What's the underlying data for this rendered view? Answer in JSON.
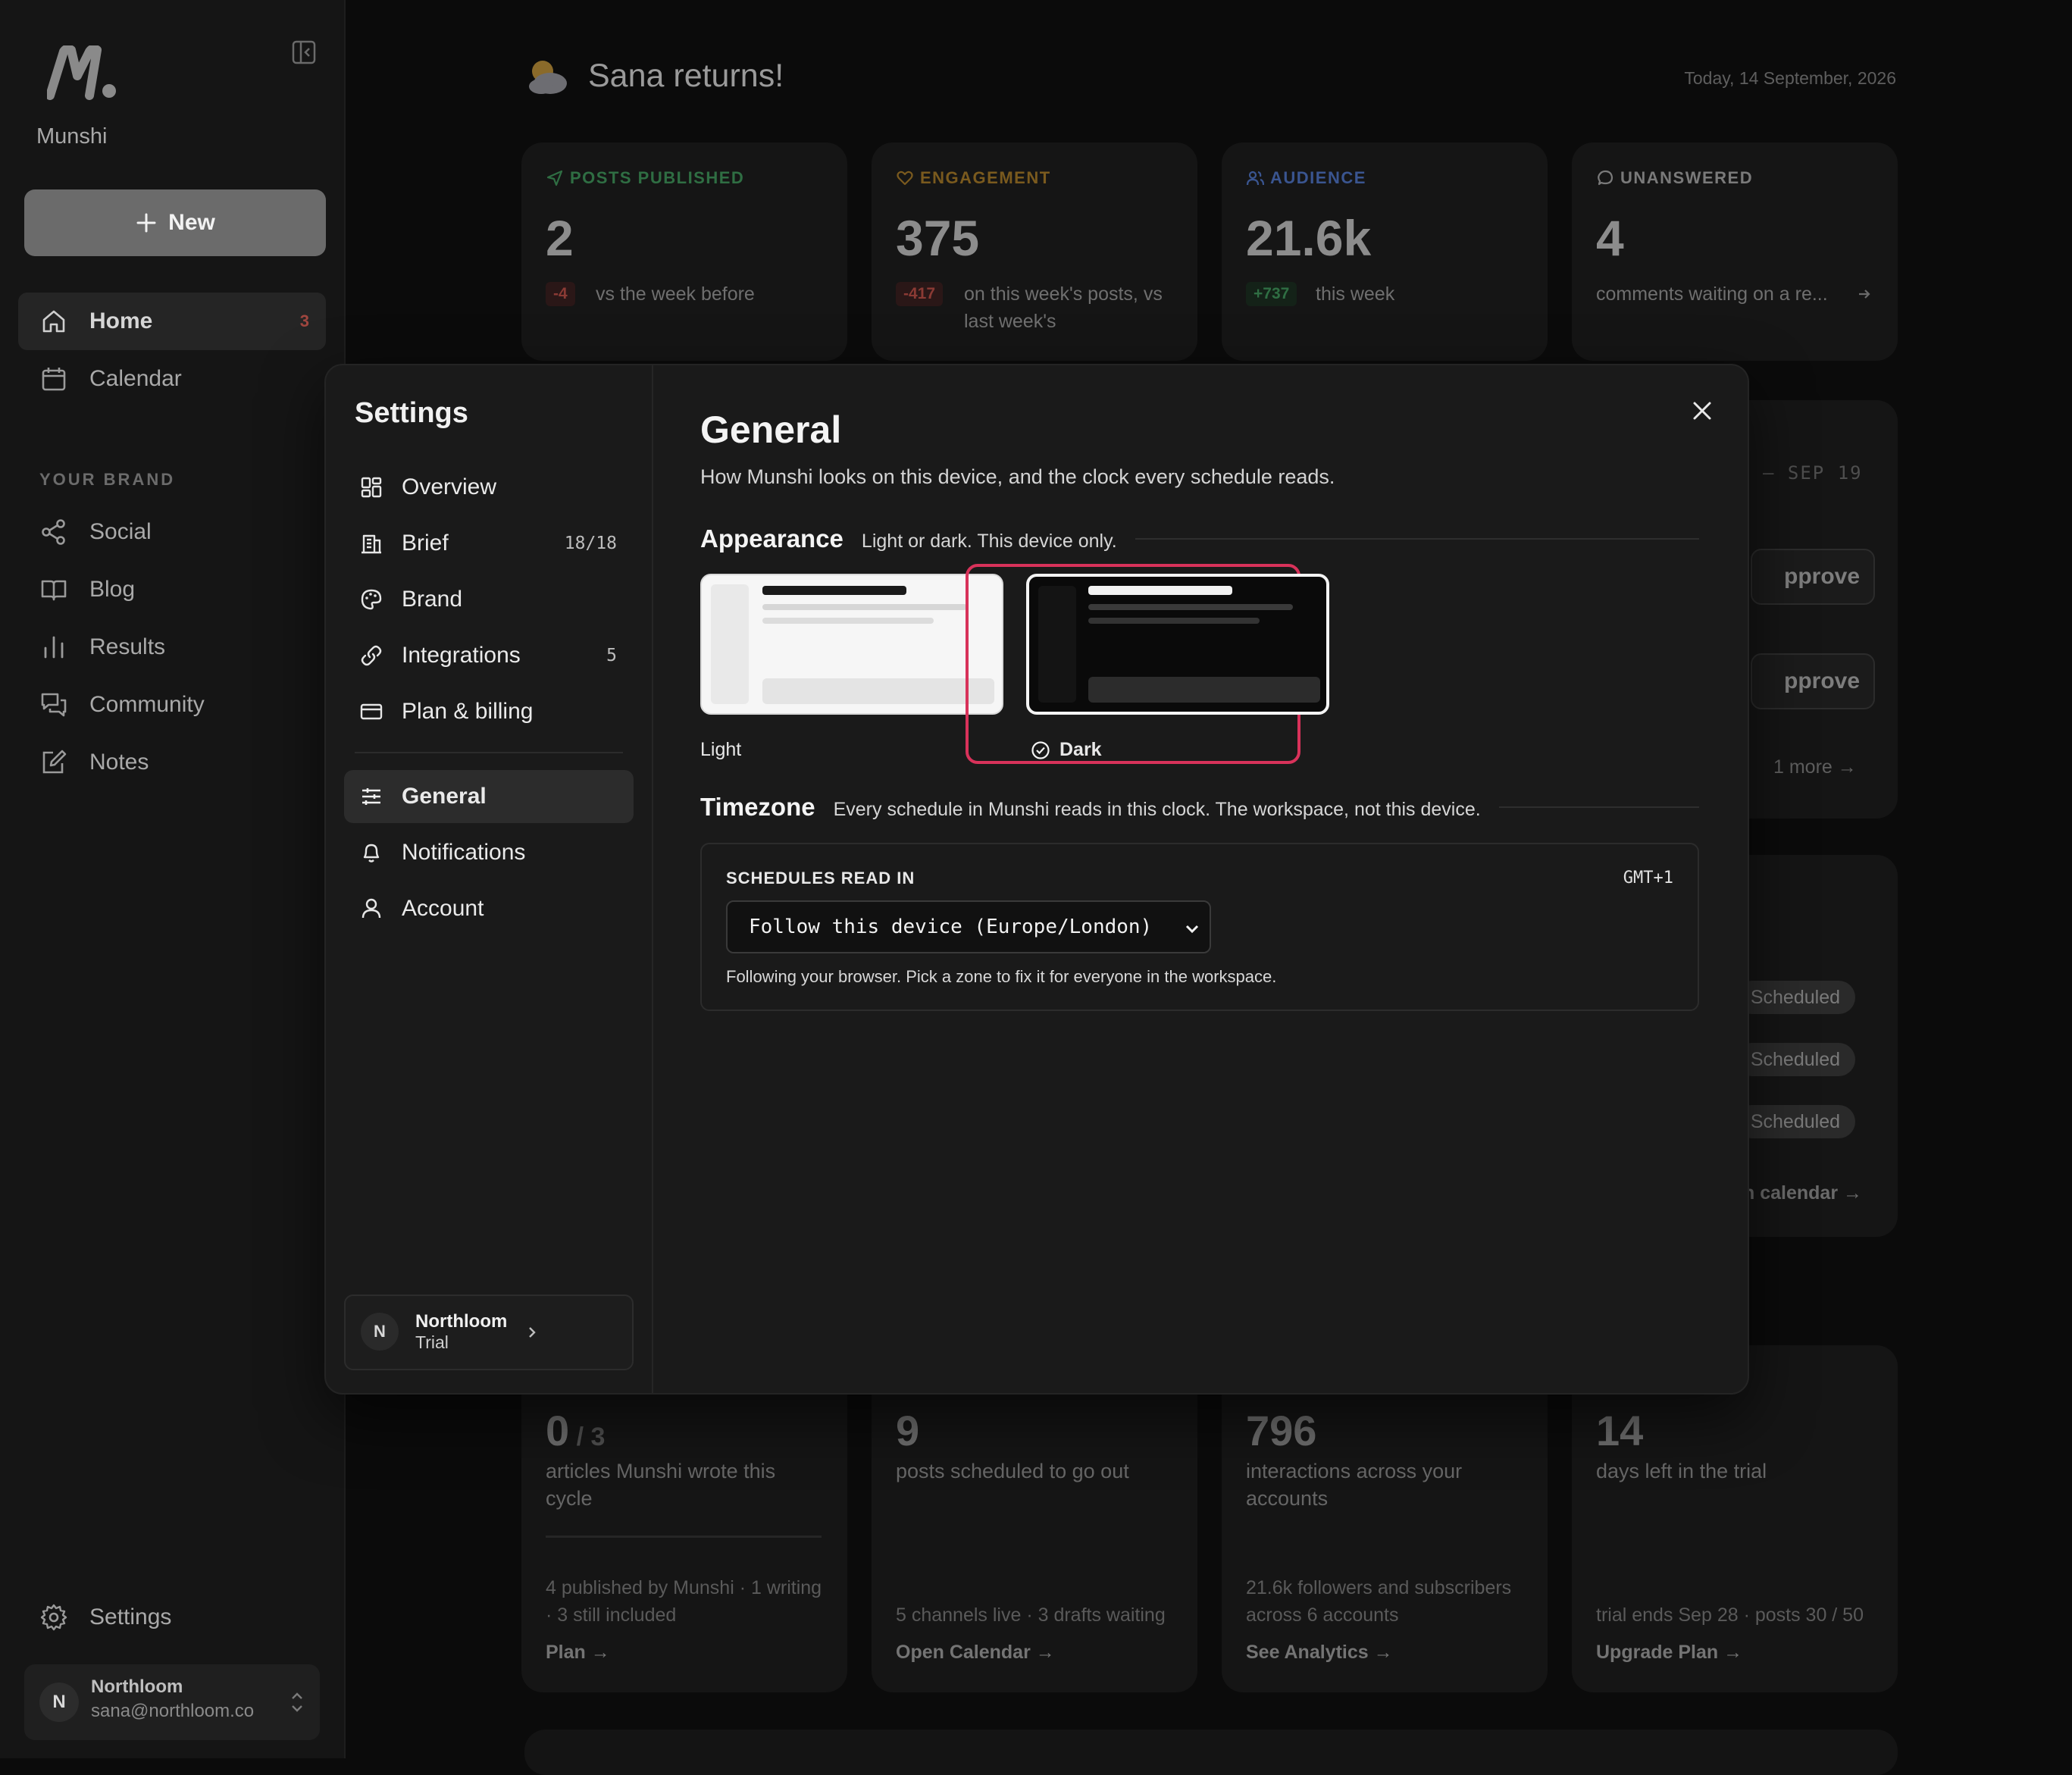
{
  "app": {
    "name": "Munshi",
    "new_label": "New",
    "nav": [
      {
        "label": "Home",
        "badge": "3"
      },
      {
        "label": "Calendar"
      }
    ],
    "brand_section_label": "YOUR BRAND",
    "brand_nav": [
      {
        "label": "Social"
      },
      {
        "label": "Blog"
      },
      {
        "label": "Results"
      },
      {
        "label": "Community"
      },
      {
        "label": "Notes"
      }
    ],
    "settings_label": "Settings",
    "user": {
      "initial": "N",
      "name": "Northloom",
      "email": "sana@northloom.co"
    }
  },
  "dashboard": {
    "greeting": "Sana returns!",
    "date": "Today, 14 September, 2026",
    "stats": [
      {
        "label": "POSTS PUBLISHED",
        "value": "2",
        "delta": "-4",
        "note": "vs the week before",
        "color": "#2f6e43"
      },
      {
        "label": "ENGAGEMENT",
        "value": "375",
        "delta": "-417",
        "note": "on this week's posts, vs last week's",
        "color": "#7a5a1e"
      },
      {
        "label": "AUDIENCE",
        "value": "21.6k",
        "delta": "+737",
        "note": "this week",
        "color": "#3a5590"
      },
      {
        "label": "UNANSWERED",
        "value": "4",
        "note": "comments waiting on a re..."
      }
    ],
    "week_range_tail": "– SEP 19",
    "approve_label": "pprove",
    "more_label": "1 more",
    "scheduled_label": "Scheduled",
    "calendar_link_tail": "n calendar →",
    "bottom_cards": [
      {
        "value": "0",
        "value_suffix": " / 3",
        "desc": "articles Munshi wrote this cycle",
        "foot": "4 published by Munshi · 1 writing · 3 still included",
        "link": "Plan →"
      },
      {
        "value": "9",
        "desc": "posts scheduled to go out",
        "foot": "5 channels live · 3 drafts waiting",
        "link": "Open Calendar →"
      },
      {
        "value": "796",
        "desc": "interactions across your accounts",
        "foot": "21.6k followers and subscribers across 6 accounts",
        "link": "See Analytics →"
      },
      {
        "value": "14",
        "desc": "days left in the trial",
        "foot": "trial ends Sep 28 · posts 30 / 50",
        "link": "Upgrade Plan →"
      }
    ]
  },
  "settings": {
    "title": "Settings",
    "nav": [
      {
        "label": "Overview"
      },
      {
        "label": "Brief",
        "count": "18/18"
      },
      {
        "label": "Brand"
      },
      {
        "label": "Integrations",
        "count": "5"
      },
      {
        "label": "Plan & billing"
      },
      {
        "label": "General",
        "active": true
      },
      {
        "label": "Notifications"
      },
      {
        "label": "Account"
      }
    ],
    "workspace": {
      "initial": "N",
      "name": "Northloom",
      "plan": "Trial"
    },
    "general": {
      "title": "General",
      "subtitle": "How Munshi looks on this device, and the clock every schedule reads.",
      "appearance": {
        "heading": "Appearance",
        "sub": "Light or dark. This device only.",
        "options": [
          {
            "label": "Light"
          },
          {
            "label": "Dark",
            "selected": true
          }
        ],
        "accent": "#d8325a"
      },
      "timezone": {
        "heading": "Timezone",
        "sub": "Every schedule in Munshi reads in this clock. The workspace, not this device.",
        "field_label": "SCHEDULES READ IN",
        "offset": "GMT+1",
        "selected": "Follow this device (Europe/London)",
        "help": "Following your browser. Pick a zone to fix it for everyone in the workspace."
      }
    }
  }
}
